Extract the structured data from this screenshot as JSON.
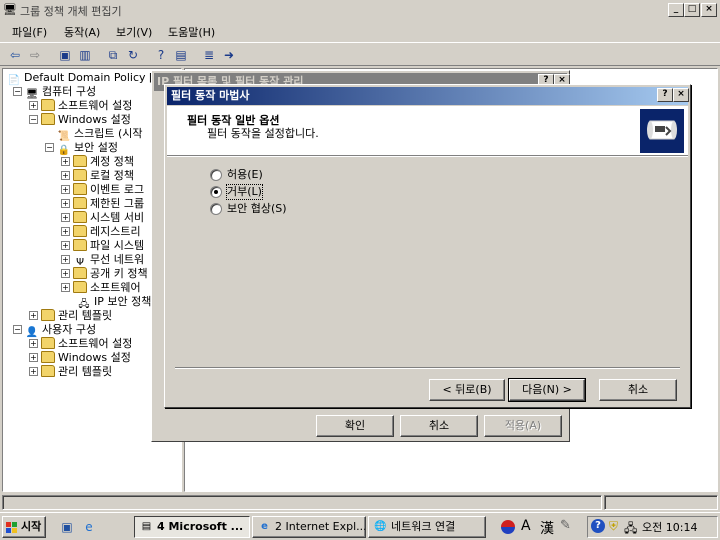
{
  "window": {
    "title": "그룹 정책 개체 편집기",
    "controls": [
      "_",
      "□",
      "×"
    ]
  },
  "menu": [
    {
      "label": "파일(F)"
    },
    {
      "label": "동작(A)"
    },
    {
      "label": "보기(V)"
    },
    {
      "label": "도움말(H)"
    }
  ],
  "tree": {
    "root": "Default Domain Policy [I",
    "computer_config": "컴퓨터 구성",
    "software_settings": "소프트웨어 설정",
    "windows_settings": "Windows 설정",
    "scripts": "스크립트 (시작",
    "security_settings": "보안 설정",
    "account_policy": "계정 정책",
    "local_policy": "로컬 정책",
    "event_log": "이벤트 로그",
    "restricted_groups": "제한된 그룹",
    "system_services": "시스템 서비",
    "registry": "레지스트리",
    "file_system": "파일 시스템",
    "wireless": "무선 네트워",
    "public_key": "공개 키 정책",
    "software_restriction": "소프트웨어",
    "ip_security": "IP 보안 정책",
    "admin_templates": "관리 템플릿",
    "user_config": "사용자 구성",
    "user_software_settings": "소프트웨어 설정",
    "user_windows_settings": "Windows 설정",
    "user_admin_templates": "관리 템플릿"
  },
  "back_dialog": {
    "title": "IP 필터 목록 및 필터 동작 관리",
    "help": "?",
    "close": "×",
    "ok": "확인",
    "cancel": "취소",
    "apply": "적용(A)"
  },
  "wizard": {
    "title": "필터 동작 마법사",
    "help": "?",
    "close": "×",
    "heading": "필터 동작 일반 옵션",
    "subheading": "필터 동작을 설정합니다.",
    "options": [
      {
        "label": "허용(E)",
        "selected": false
      },
      {
        "label": "거부(L)",
        "selected": true
      },
      {
        "label": "보안 협상(S)",
        "selected": false
      }
    ],
    "back": "< 뒤로(B)",
    "next": "다음(N) >",
    "cancel": "취소"
  },
  "taskbar": {
    "start": "시작",
    "tasks": [
      {
        "label": "4 Microsoft ...",
        "active": true
      },
      {
        "label": "2 Internet Expl...",
        "active": false
      },
      {
        "label": "네트워크 연결",
        "active": false
      }
    ],
    "ime": [
      "A",
      "漢"
    ],
    "clock": "오전 10:14"
  }
}
